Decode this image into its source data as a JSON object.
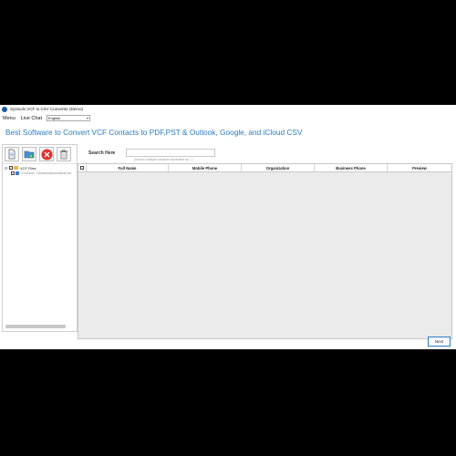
{
  "window": {
    "title": "Systools VCF to CSV Converter (Demo)"
  },
  "menu": {
    "items": [
      "Menu",
      "Live Chat"
    ],
    "language": "English"
  },
  "headline": "Best Software to Convert VCF Contacts to PDF,PST & Outlook, Google, and iCloud CSV",
  "toolbar": {
    "icons": [
      "add-file-icon",
      "add-folder-icon",
      "remove-icon",
      "delete-icon"
    ]
  },
  "tree": {
    "root_label": "VCF Files",
    "child_path": "C:\\Users\\...\\Downloads\\contacts.vcf"
  },
  "search": {
    "label": "Search Here",
    "arrow": ">",
    "placeholder": "",
    "hint": "(search multiple contacts separated by ',')"
  },
  "table": {
    "columns": [
      "Full Name",
      "Mobile Phone",
      "Organization",
      "Business Phone",
      "Preview"
    ]
  },
  "footer": {
    "next_label": "Next"
  },
  "colors": {
    "accent": "#2a7bbf",
    "grid_bg": "#ebebeb",
    "remove_red": "#e0322d",
    "folder_yellow": "#e8b84a"
  }
}
